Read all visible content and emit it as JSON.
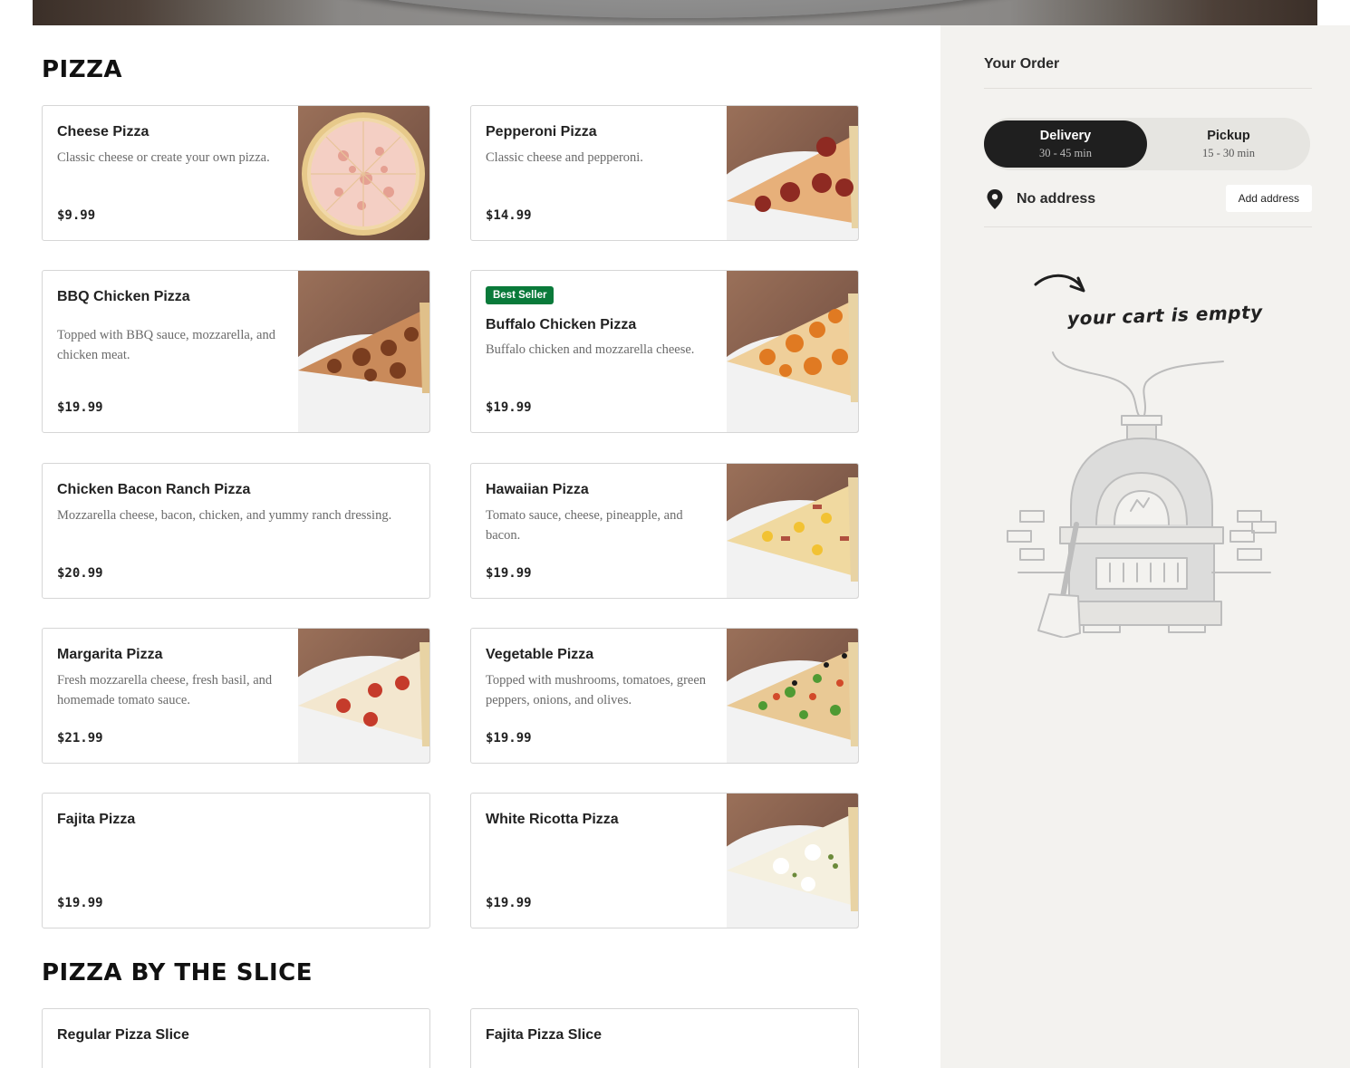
{
  "sections": [
    {
      "title": "PIZZA",
      "items": [
        {
          "name": "Cheese Pizza",
          "description": "Classic cheese or create your own pizza.",
          "price": "$9.99",
          "image": "cheese-pizza-photo"
        },
        {
          "name": "Pepperoni Pizza",
          "description": "Classic cheese and pepperoni.",
          "price": "$14.99",
          "image": "pepperoni-slice-photo"
        },
        {
          "name": "BBQ Chicken Pizza",
          "description": "Topped with BBQ sauce, mozzarella, and chicken meat.",
          "price": "$19.99",
          "image": "bbq-chicken-slice-photo"
        },
        {
          "name": "Buffalo Chicken Pizza",
          "badge": "Best Seller",
          "description": "Buffalo chicken and mozzarella cheese.",
          "price": "$19.99",
          "image": "buffalo-chicken-slice-photo"
        },
        {
          "name": "Chicken Bacon Ranch Pizza",
          "description": "Mozzarella cheese, bacon, chicken, and yummy ranch dressing.",
          "price": "$20.99"
        },
        {
          "name": "Hawaiian Pizza",
          "description": "Tomato sauce, cheese, pineapple, and bacon.",
          "price": "$19.99",
          "image": "hawaiian-slice-photo"
        },
        {
          "name": "Margarita Pizza",
          "description": "Fresh mozzarella cheese, fresh basil, and homemade tomato sauce.",
          "price": "$21.99",
          "image": "margarita-slice-photo"
        },
        {
          "name": "Vegetable Pizza",
          "description": "Topped with mushrooms, tomatoes, green peppers, onions, and olives.",
          "price": "$19.99",
          "image": "vegetable-slice-photo"
        },
        {
          "name": "Fajita Pizza",
          "price": "$19.99"
        },
        {
          "name": "White Ricotta Pizza",
          "price": "$19.99",
          "image": "white-ricotta-slice-photo"
        }
      ]
    },
    {
      "title": "PIZZA BY THE SLICE",
      "items": [
        {
          "name": "Regular Pizza Slice"
        },
        {
          "name": "Fajita Pizza Slice"
        }
      ]
    }
  ],
  "order": {
    "title": "Your Order",
    "modes": [
      {
        "label": "Delivery",
        "time": "30 - 45 min",
        "active": true
      },
      {
        "label": "Pickup",
        "time": "15 - 30 min",
        "active": false
      }
    ],
    "address_label": "No address",
    "add_address_button": "Add address",
    "empty_cart_text": "your cart is empty",
    "empty_cart_icon": "pizza-oven-illustration",
    "pin_icon": "location-pin-icon"
  },
  "colors": {
    "badge_green": "#0a7a3a",
    "toggle_active": "#1f1f1f",
    "sidebar_bg": "#f3f2ef"
  }
}
